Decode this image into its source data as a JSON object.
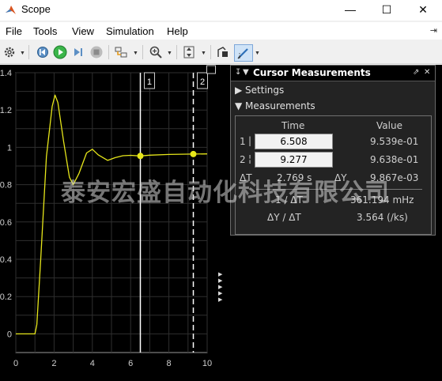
{
  "window": {
    "title": "Scope"
  },
  "menu": [
    "File",
    "Tools",
    "View",
    "Simulation",
    "Help"
  ],
  "toolbar": {
    "icons": [
      "gear-icon",
      "step-back-icon",
      "run-icon",
      "step-forward-icon",
      "stop-icon",
      "highlight-block-icon",
      "zoom-icon",
      "fit-to-view-icon",
      "cursor-data-icon",
      "cursor-measurements-icon"
    ]
  },
  "plot": {
    "background": "#000000",
    "signal_color": "#e6e61a",
    "cursor1_label": "1",
    "cursor2_label": "2",
    "xticks": [
      "0",
      "2",
      "4",
      "6",
      "8",
      "10"
    ],
    "yticks": [
      "1.4",
      "1.2",
      "1",
      "0.8",
      "0.6",
      "0.4",
      "0.2",
      "0"
    ]
  },
  "chart_data": {
    "type": "line",
    "title": "",
    "xlabel": "",
    "ylabel": "",
    "xlim": [
      0,
      10
    ],
    "ylim": [
      -0.1,
      1.4
    ],
    "grid": true,
    "series": [
      {
        "x": [
          0,
          1.0,
          1.1,
          1.3,
          1.6,
          1.9,
          2.05,
          2.2,
          2.5,
          2.8,
          3.0,
          3.3,
          3.7,
          4.0,
          4.3,
          4.8,
          5.2,
          5.6,
          6.0,
          6.508,
          7.0,
          8.0,
          9.277,
          10.0
        ],
        "y": [
          0,
          0,
          0.05,
          0.4,
          0.95,
          1.22,
          1.28,
          1.24,
          1.03,
          0.84,
          0.8,
          0.86,
          0.97,
          0.99,
          0.96,
          0.93,
          0.945,
          0.955,
          0.957,
          0.954,
          0.958,
          0.962,
          0.964,
          0.965
        ]
      }
    ],
    "cursors": [
      6.508,
      9.277
    ]
  },
  "panel": {
    "title": "Cursor Measurements",
    "settings": "Settings",
    "measurements": "Measurements",
    "col_time": "Time",
    "col_value": "Value",
    "row1_label": "1",
    "row1_time": "6.508",
    "row1_value": "9.539e-01",
    "row2_label": "2",
    "row2_time": "9.277",
    "row2_value": "9.638e-01",
    "dt_label": "ΔT",
    "dt_value": "2.769 s",
    "dy_label": "ΔY",
    "dy_value": "9.867e-03",
    "inv_dt_label": "1 / ΔT",
    "inv_dt_value": "361.194 mHz",
    "slope_label": "ΔY / ΔT",
    "slope_value": "3.564 (/ks)"
  },
  "watermark": "泰安宏盛自动化科技有限公司"
}
